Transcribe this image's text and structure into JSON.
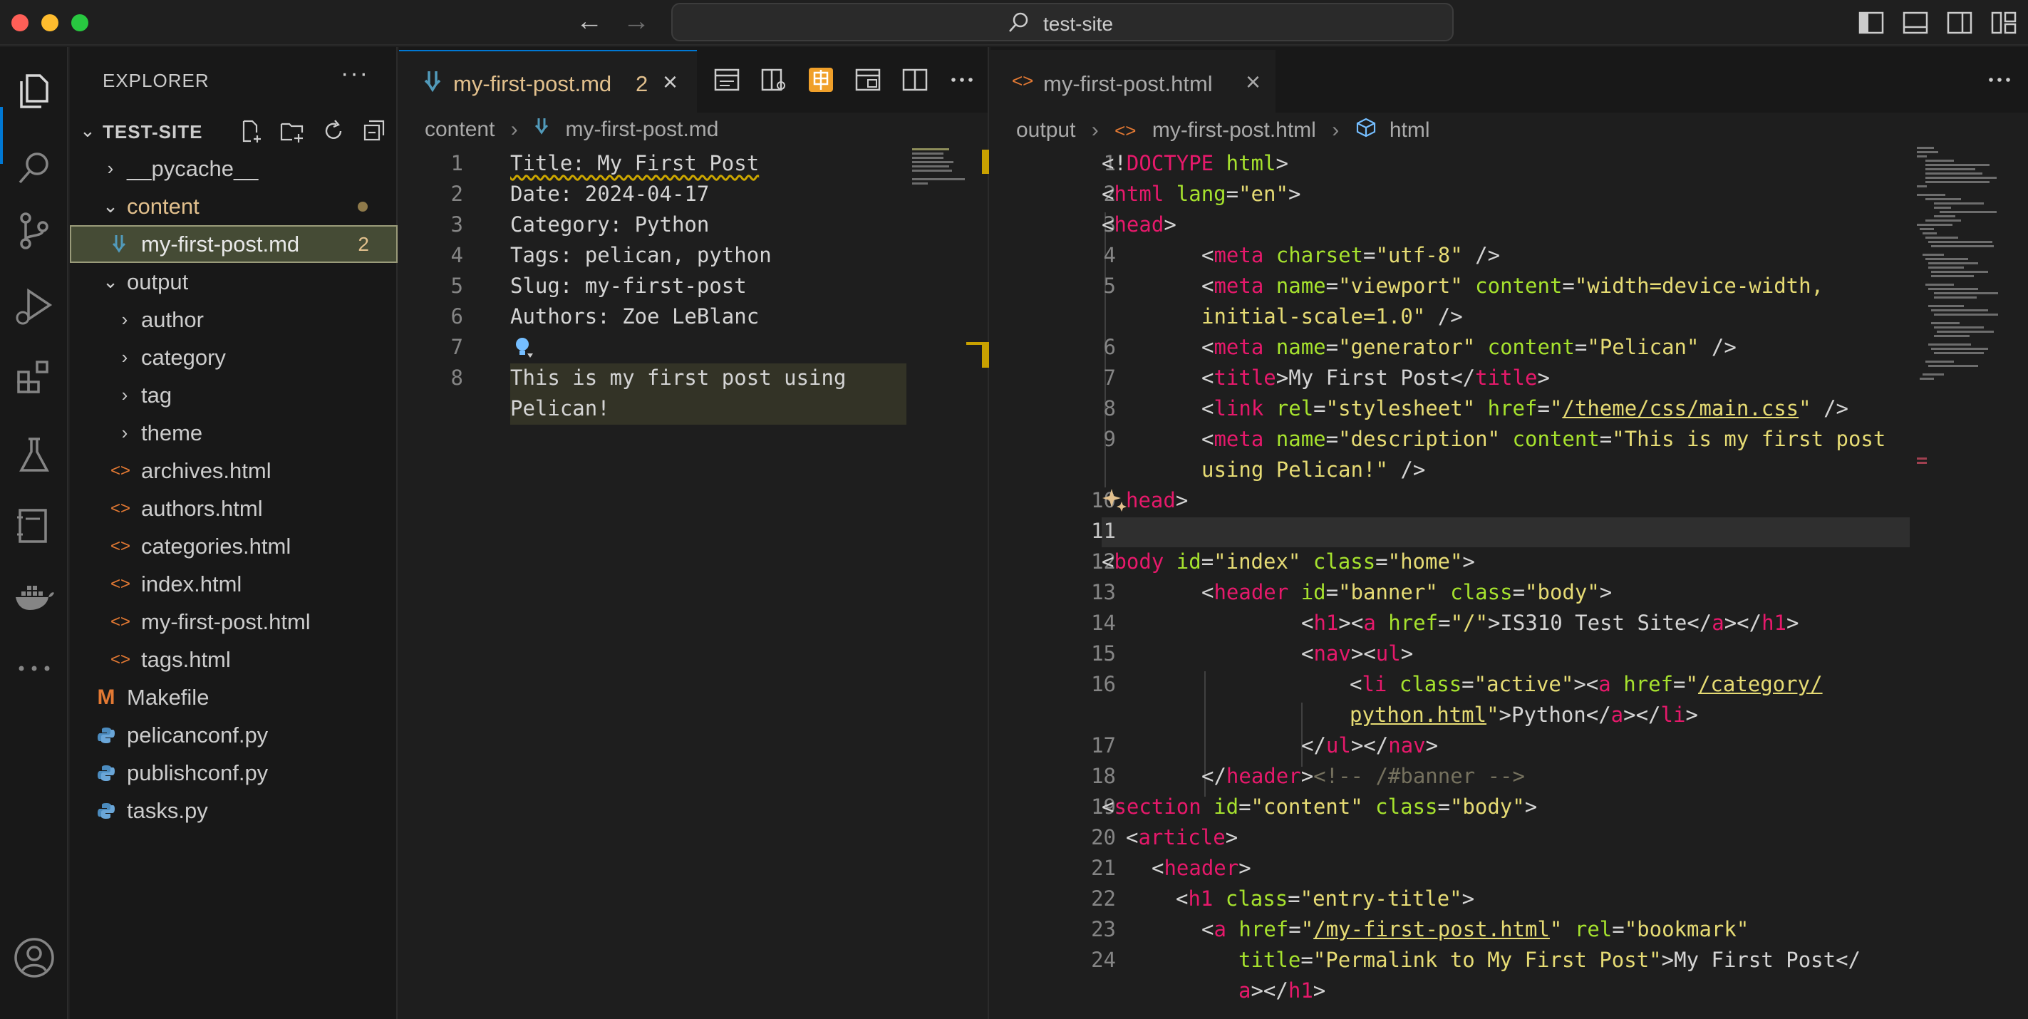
{
  "window": {
    "search_text": "test-site"
  },
  "sidebar": {
    "title": "EXPLORER",
    "more": "···",
    "section_name": "TEST-SITE",
    "tree": [
      {
        "label": "__pycache__",
        "type": "folder",
        "expanded": false,
        "depth": 1
      },
      {
        "label": "content",
        "type": "folder",
        "expanded": true,
        "depth": 1,
        "modified": true
      },
      {
        "label": "my-first-post.md",
        "type": "markdown",
        "depth": 2,
        "badge": "2",
        "selected": true
      },
      {
        "label": "output",
        "type": "folder",
        "expanded": true,
        "depth": 1
      },
      {
        "label": "author",
        "type": "folder",
        "expanded": false,
        "depth": 2
      },
      {
        "label": "category",
        "type": "folder",
        "expanded": false,
        "depth": 2
      },
      {
        "label": "tag",
        "type": "folder",
        "expanded": false,
        "depth": 2
      },
      {
        "label": "theme",
        "type": "folder",
        "expanded": false,
        "depth": 2
      },
      {
        "label": "archives.html",
        "type": "html",
        "depth": 2
      },
      {
        "label": "authors.html",
        "type": "html",
        "depth": 2
      },
      {
        "label": "categories.html",
        "type": "html",
        "depth": 2
      },
      {
        "label": "index.html",
        "type": "html",
        "depth": 2
      },
      {
        "label": "my-first-post.html",
        "type": "html",
        "depth": 2
      },
      {
        "label": "tags.html",
        "type": "html",
        "depth": 2
      },
      {
        "label": "Makefile",
        "type": "makefile",
        "depth": 1
      },
      {
        "label": "pelicanconf.py",
        "type": "python",
        "depth": 1
      },
      {
        "label": "publishconf.py",
        "type": "python",
        "depth": 1
      },
      {
        "label": "tasks.py",
        "type": "python",
        "depth": 1
      }
    ]
  },
  "editor1": {
    "tab_label": "my-first-post.md",
    "tab_badge": "2",
    "breadcrumb": [
      "content",
      "my-first-post.md"
    ],
    "lines": [
      {
        "n": "1",
        "text": "Title: My First Post"
      },
      {
        "n": "2",
        "text": "Date: 2024-04-17"
      },
      {
        "n": "3",
        "text": "Category: Python"
      },
      {
        "n": "4",
        "text": "Tags: pelican, python"
      },
      {
        "n": "5",
        "text": "Slug: my-first-post"
      },
      {
        "n": "6",
        "text": "Authors: Zoe LeBlanc"
      },
      {
        "n": "7",
        "text": ""
      },
      {
        "n": "8",
        "text": "This is my first post using"
      },
      {
        "n": "",
        "text": "Pelican!"
      }
    ]
  },
  "editor2": {
    "tab_label": "my-first-post.html",
    "breadcrumb": [
      "output",
      "my-first-post.html",
      "html"
    ],
    "line_numbers": [
      "1",
      "2",
      "3",
      "4",
      "5",
      "",
      "6",
      "7",
      "8",
      "9",
      "",
      "10",
      "11",
      "12",
      "13",
      "14",
      "15",
      "16",
      "",
      "17",
      "18",
      "19",
      "20",
      "21",
      "22",
      "23",
      "24",
      ""
    ]
  },
  "colors": {
    "accent": "#0078d4",
    "tab_active_text": "#e2c08d",
    "tag": "#e6196b",
    "attr": "#a6e22e",
    "string": "#e6db74",
    "comment": "#75715e"
  }
}
